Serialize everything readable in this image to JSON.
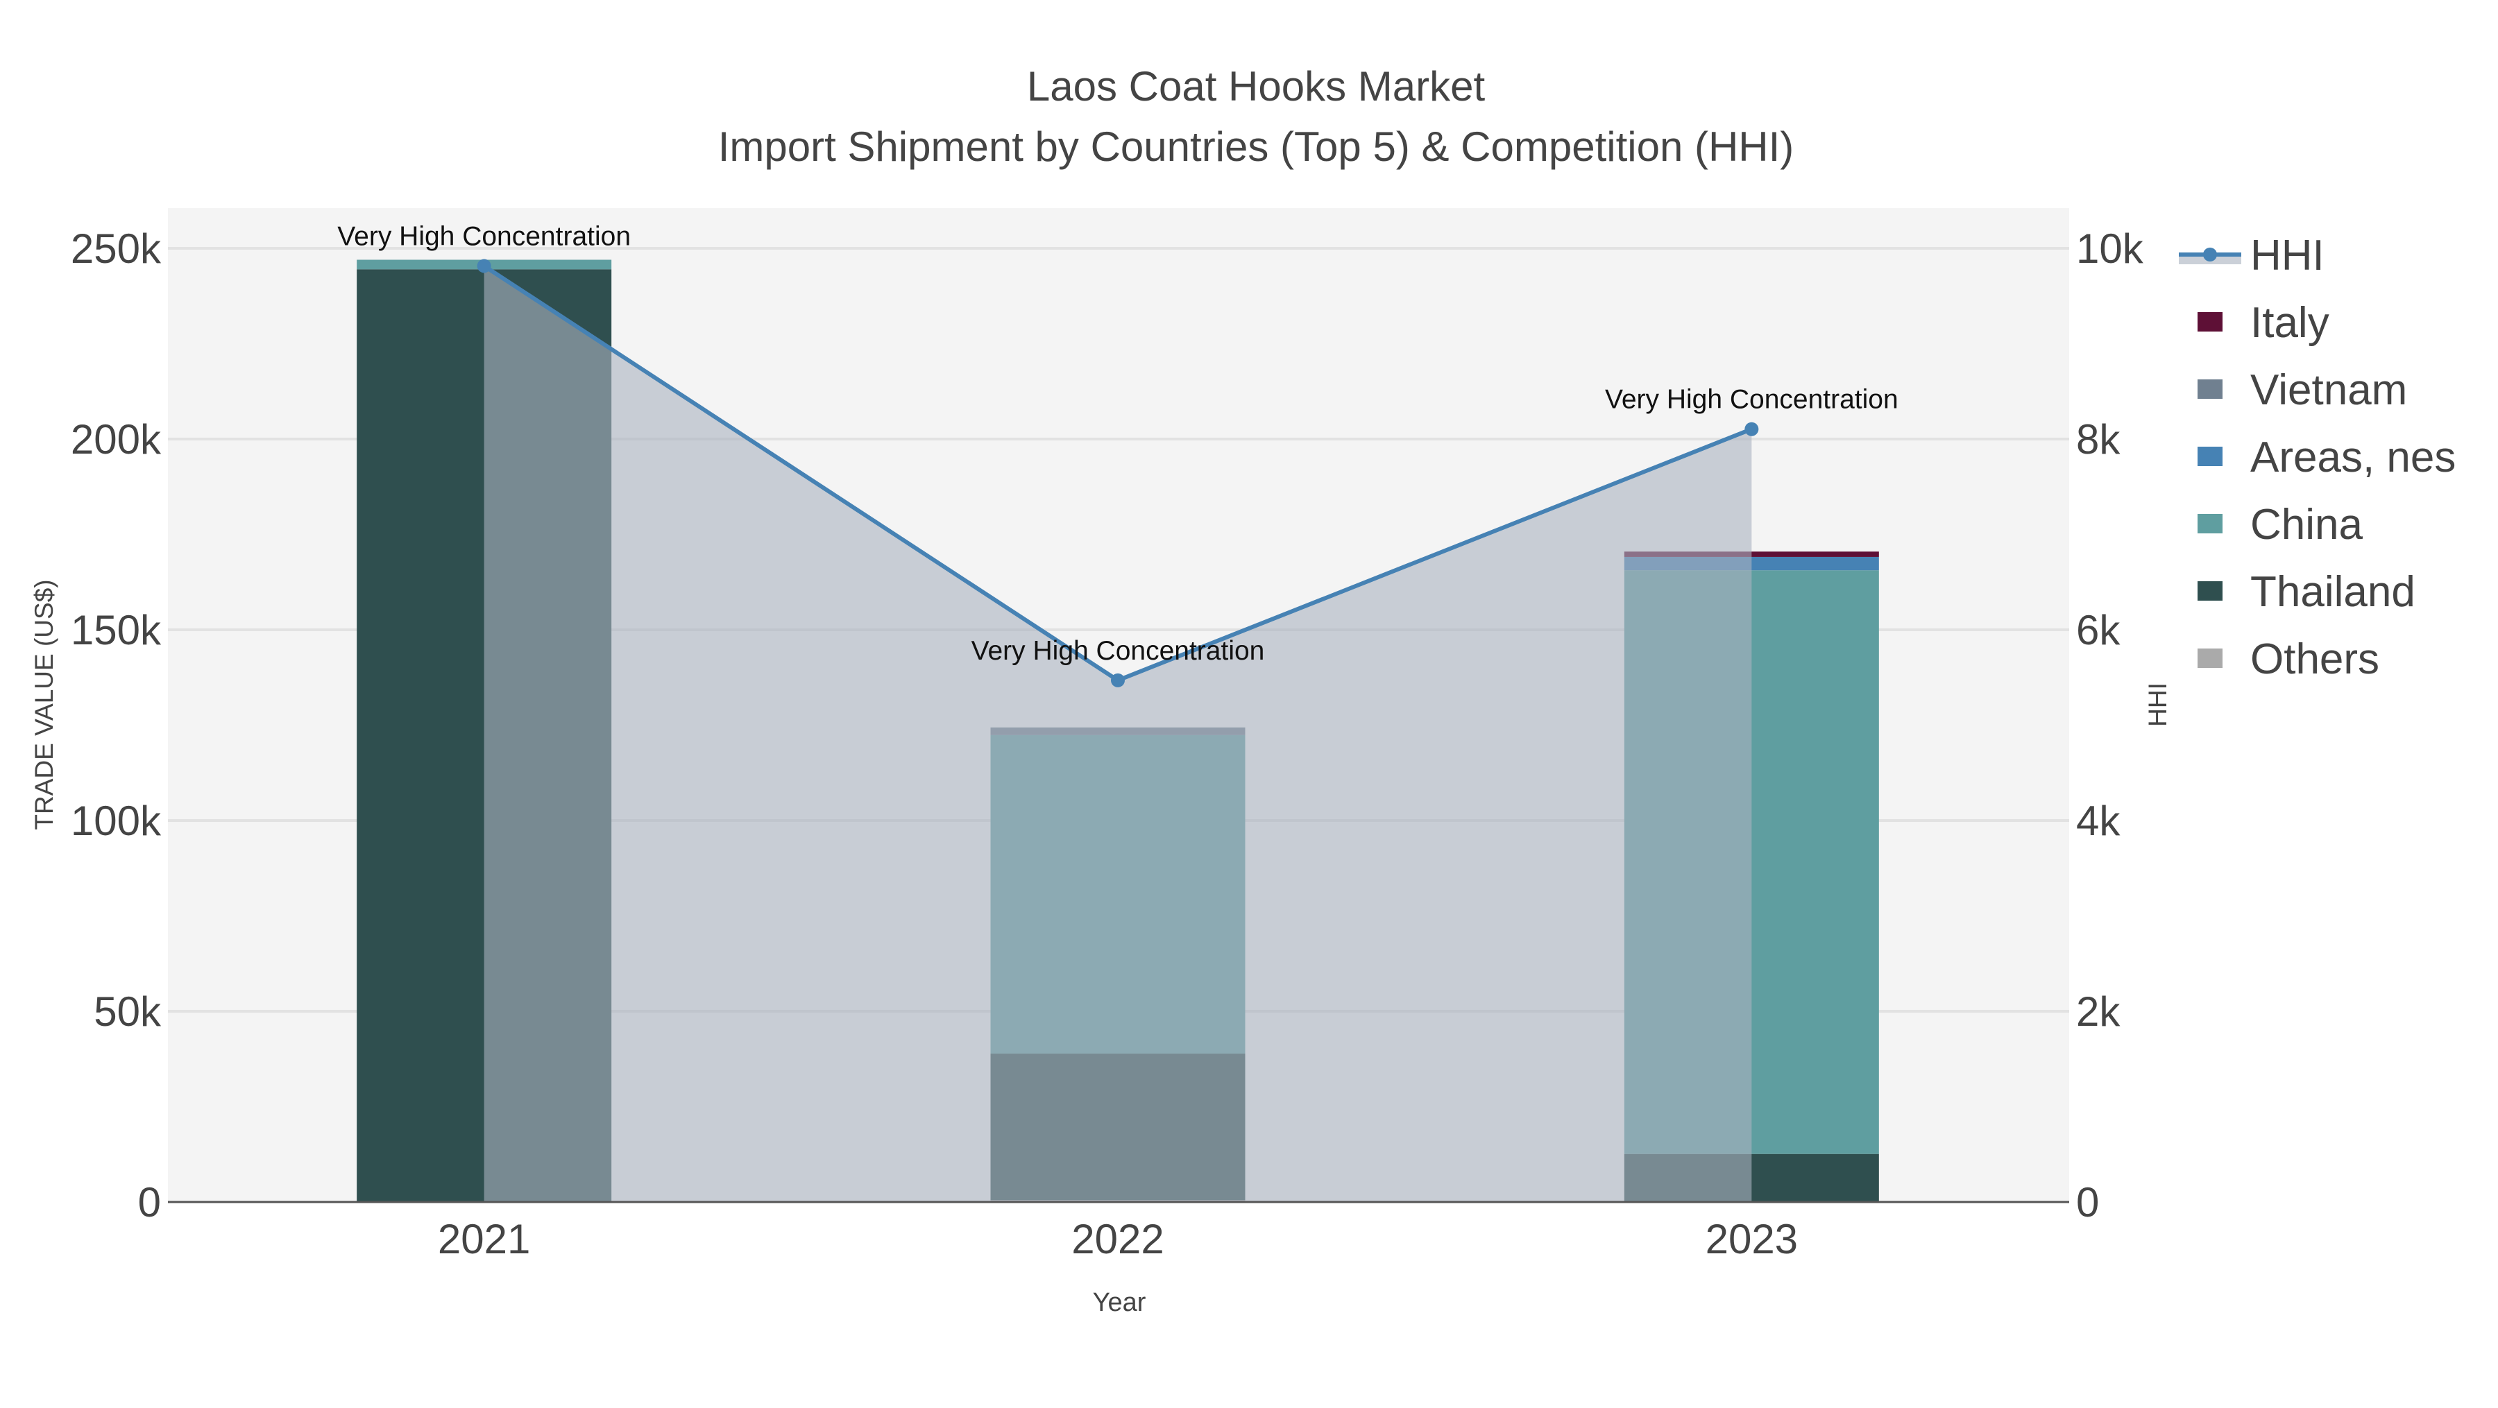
{
  "chart_data": {
    "type": "bar",
    "title": "Laos Coat Hooks Market",
    "subtitle": "Import Shipment by Countries (Top 5) & Competition (HHI)",
    "xlabel": "Year",
    "ylabel": "TRADE VALUE (US$)",
    "y2label": "HHI",
    "categories": [
      "2021",
      "2022",
      "2023"
    ],
    "ylim": [
      0,
      260000
    ],
    "y2lim": [
      0,
      10400
    ],
    "yticks": [
      {
        "v": 0,
        "label": "0"
      },
      {
        "v": 50000,
        "label": "50k"
      },
      {
        "v": 100000,
        "label": "100k"
      },
      {
        "v": 150000,
        "label": "150k"
      },
      {
        "v": 200000,
        "label": "200k"
      },
      {
        "v": 250000,
        "label": "250k"
      }
    ],
    "y2ticks": [
      {
        "v": 0,
        "label": "0"
      },
      {
        "v": 2000,
        "label": "2k"
      },
      {
        "v": 4000,
        "label": "4k"
      },
      {
        "v": 6000,
        "label": "6k"
      },
      {
        "v": 8000,
        "label": "8k"
      },
      {
        "v": 10000,
        "label": "10k"
      }
    ],
    "grid": true,
    "legend_position": "right",
    "series": [
      {
        "name": "Others",
        "color": "#aaaaaa",
        "values": [
          0,
          500,
          0
        ]
      },
      {
        "name": "Thailand",
        "color": "#2f4f4f",
        "values": [
          244500,
          38400,
          12600
        ]
      },
      {
        "name": "China",
        "color": "#5f9ea0",
        "values": [
          2500,
          83500,
          153000
        ]
      },
      {
        "name": "Areas, nes",
        "color": "#4682b4",
        "values": [
          0,
          0,
          3500
        ]
      },
      {
        "name": "Vietnam",
        "color": "#708090",
        "values": [
          0,
          2000,
          0
        ]
      },
      {
        "name": "Italy",
        "color": "#5e1036",
        "values": [
          0,
          0,
          1400
        ]
      }
    ],
    "hhi": {
      "name": "HHI",
      "color": "#4682b4",
      "values": [
        9815,
        5470,
        8104
      ],
      "annotations": [
        "Very High Concentration",
        "Very High Concentration",
        "Very High Concentration"
      ]
    },
    "legend_order": [
      "HHI",
      "Italy",
      "Vietnam",
      "Areas, nes",
      "China",
      "Thailand",
      "Others"
    ]
  }
}
